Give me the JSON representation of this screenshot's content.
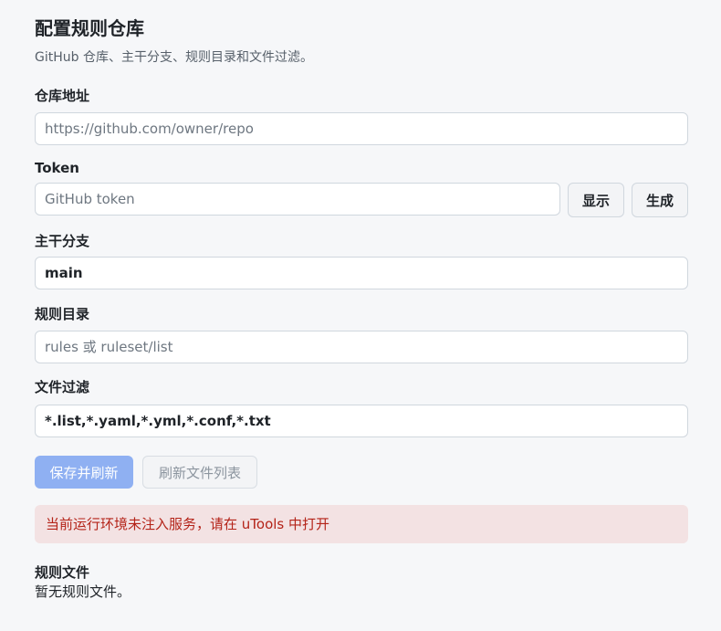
{
  "header": {
    "title": "配置规则仓库",
    "subtitle": "GitHub 仓库、主干分支、规则目录和文件过滤。"
  },
  "form": {
    "repo": {
      "label": "仓库地址",
      "value": "",
      "placeholder": "https://github.com/owner/repo"
    },
    "token": {
      "label": "Token",
      "value": "",
      "placeholder": "GitHub token",
      "show_label": "显示",
      "generate_label": "生成"
    },
    "branch": {
      "label": "主干分支",
      "value": "main",
      "placeholder": ""
    },
    "rules_dir": {
      "label": "规则目录",
      "value": "",
      "placeholder": "rules 或 ruleset/list"
    },
    "file_filter": {
      "label": "文件过滤",
      "value": "*.list,*.yaml,*.yml,*.conf,*.txt",
      "placeholder": ""
    }
  },
  "actions": {
    "save_label": "保存并刷新",
    "refresh_label": "刷新文件列表"
  },
  "alert": {
    "message": "当前运行环境未注入服务，请在 uTools 中打开"
  },
  "files": {
    "title": "规则文件",
    "empty": "暂无规则文件。"
  },
  "colors": {
    "primary_button": "#8fb0f2",
    "alert_bg": "#f3e2e3",
    "alert_text": "#b42318",
    "page_bg": "#f6f7f9"
  }
}
